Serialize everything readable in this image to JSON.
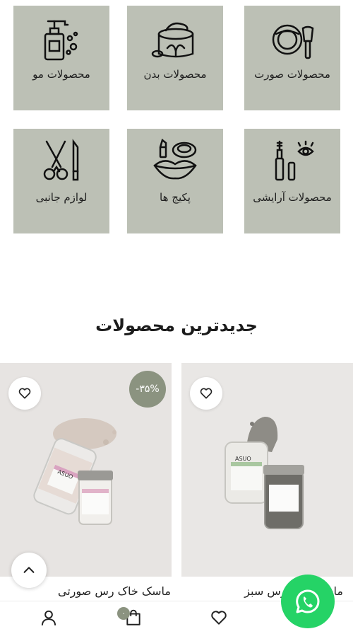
{
  "categories": [
    {
      "label": "محصولات مو",
      "icon": "hair-products-icon"
    },
    {
      "label": "محصولات بدن",
      "icon": "body-products-icon"
    },
    {
      "label": "محصولات صورت",
      "icon": "face-products-icon"
    },
    {
      "label": "لوازم جانبی",
      "icon": "accessories-icon"
    },
    {
      "label": "پکیج ها",
      "icon": "packages-icon"
    },
    {
      "label": "محصولات آرایشی",
      "icon": "makeup-products-icon"
    }
  ],
  "section": {
    "title": "جدیدترین محصولات"
  },
  "products": [
    {
      "name": "ماسک خاک رس صورتی",
      "discount": "-۳۵%",
      "jar_brand": "ASUO"
    },
    {
      "name": "ماسک خاک رس سبز",
      "jar_brand": "ASUO"
    }
  ],
  "cart": {
    "count": "۰"
  },
  "colors": {
    "tile_bg": "#bcc0b5",
    "accent": "#8b9380",
    "whatsapp": "#25d366"
  }
}
